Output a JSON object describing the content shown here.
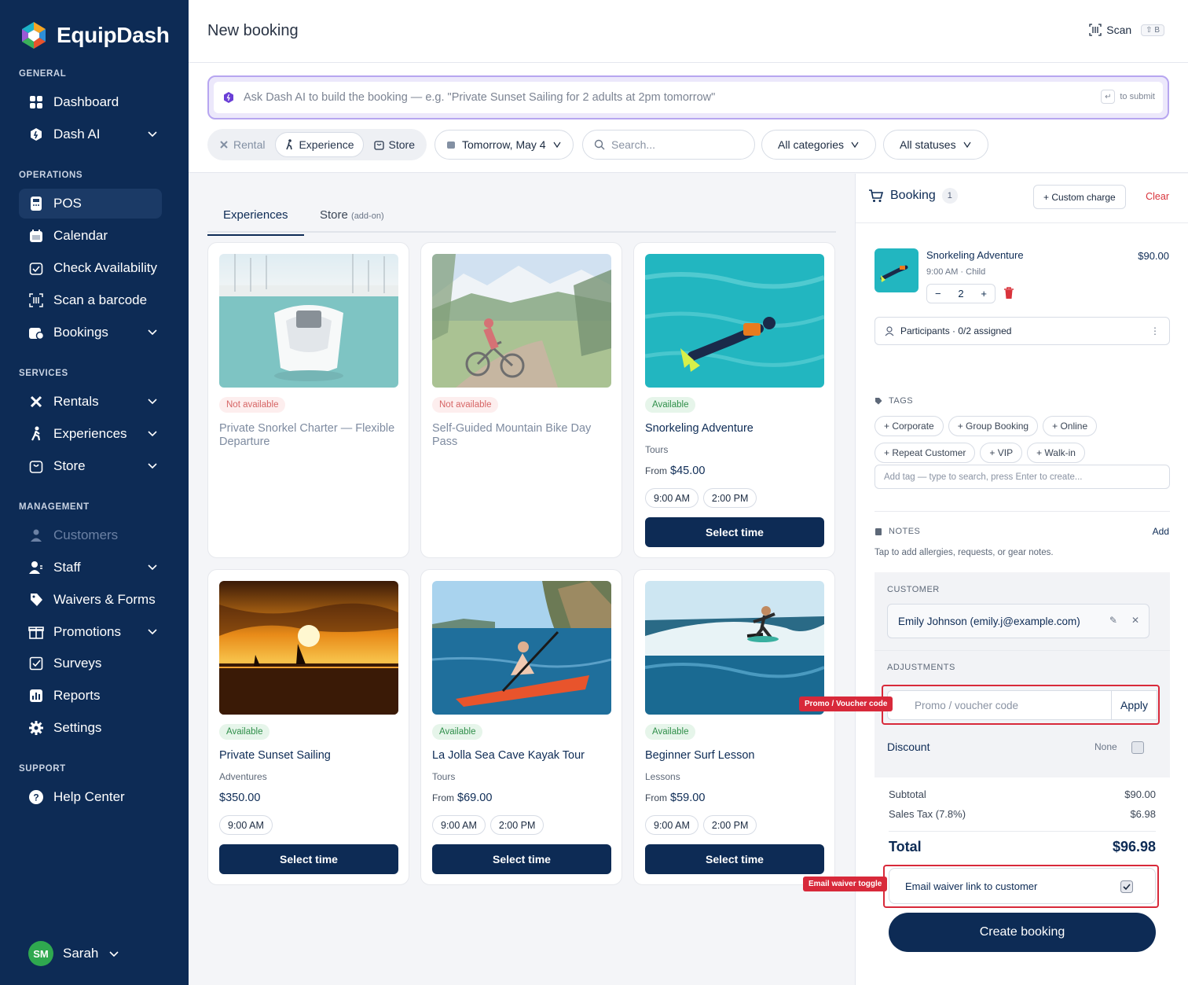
{
  "app": {
    "name": "EquipDash"
  },
  "sidebar": {
    "sections": {
      "general": "GENERAL",
      "operations": "OPERATIONS",
      "services": "SERVICES",
      "management": "MANAGEMENT",
      "support": "SUPPORT"
    },
    "items": {
      "dashboard": "Dashboard",
      "dash_ai": "Dash AI",
      "pos": "POS",
      "calendar": "Calendar",
      "check_availability": "Check Availability",
      "scan_barcode": "Scan a barcode",
      "bookings": "Bookings",
      "rentals": "Rentals",
      "experiences": "Experiences",
      "store": "Store",
      "customers": "Customers",
      "staff": "Staff",
      "waivers": "Waivers & Forms",
      "promotions": "Promotions",
      "surveys": "Surveys",
      "reports": "Reports",
      "settings": "Settings",
      "help": "Help Center"
    },
    "user": {
      "initials": "SM",
      "name": "Sarah"
    }
  },
  "header": {
    "title": "New booking",
    "scan_label": "Scan",
    "scan_shortcut": "⇧ B"
  },
  "ai": {
    "placeholder": "Ask Dash AI to build the booking — e.g. \"Private Sunset Sailing for 2 adults at 2pm tomorrow\"",
    "submit_hint": "to submit"
  },
  "filters": {
    "modes": [
      "Rental",
      "Experience",
      "Store"
    ],
    "date": "Tomorrow, May 4",
    "search_placeholder": "Search...",
    "category": "All categories",
    "status": "All statuses"
  },
  "tabs": {
    "experiences": "Experiences",
    "store": "Store",
    "store_note": "(add-on)"
  },
  "cards": [
    {
      "status": "Not available",
      "title": "Private Snorkel Charter — Flexible Departure"
    },
    {
      "status": "Not available",
      "title": "Self-Guided Mountain Bike Day Pass"
    },
    {
      "status": "Available",
      "title": "Snorkeling Adventure",
      "category": "Tours",
      "from": "From",
      "price": "$45.00",
      "times": [
        "9:00 AM",
        "2:00 PM"
      ],
      "button": "Select time"
    },
    {
      "status": "Available",
      "title": "Private Sunset Sailing",
      "category": "Adventures",
      "price": "$350.00",
      "times": [
        "9:00 AM"
      ],
      "button": "Select time"
    },
    {
      "status": "Available",
      "title": "La Jolla Sea Cave Kayak Tour",
      "category": "Tours",
      "from": "From",
      "price": "$69.00",
      "times": [
        "9:00 AM",
        "2:00 PM"
      ],
      "button": "Select time"
    },
    {
      "status": "Available",
      "title": "Beginner Surf Lesson",
      "category": "Lessons",
      "from": "From",
      "price": "$59.00",
      "times": [
        "9:00 AM",
        "2:00 PM"
      ],
      "button": "Select time"
    }
  ],
  "booking": {
    "title": "Booking",
    "count": "1",
    "custom_charge": "+ Custom charge",
    "clear": "Clear",
    "item": {
      "name": "Snorkeling Adventure",
      "time": "9:00 AM",
      "type": "Child",
      "price": "$90.00",
      "qty": "2"
    },
    "participants": "Participants · 0/2 assigned",
    "tags_label": "TAGS",
    "tags": [
      "+ Corporate",
      "+ Group Booking",
      "+ Online",
      "+ Repeat Customer",
      "+ VIP",
      "+ Walk-in"
    ],
    "tag_placeholder": "Add tag — type to search, press Enter to create...",
    "notes_label": "NOTES",
    "notes_add": "Add",
    "notes_hint": "Tap to add allergies, requests, or gear notes.",
    "customer_label": "CUSTOMER",
    "customer": "Emily Johnson (emily.j@example.com)",
    "adjustments_label": "ADJUSTMENTS",
    "promo_placeholder": "Promo / voucher code",
    "apply": "Apply",
    "discount": "Discount",
    "discount_value": "None",
    "subtotal_label": "Subtotal",
    "subtotal": "$90.00",
    "tax_label": "Sales Tax (7.8%)",
    "tax": "$6.98",
    "total_label": "Total",
    "total": "$96.98",
    "waiver": "Email waiver link to customer",
    "waiver_checked": true,
    "create": "Create booking"
  },
  "annotations": {
    "promo": "Promo / Voucher code",
    "waiver": "Email waiver toggle"
  }
}
